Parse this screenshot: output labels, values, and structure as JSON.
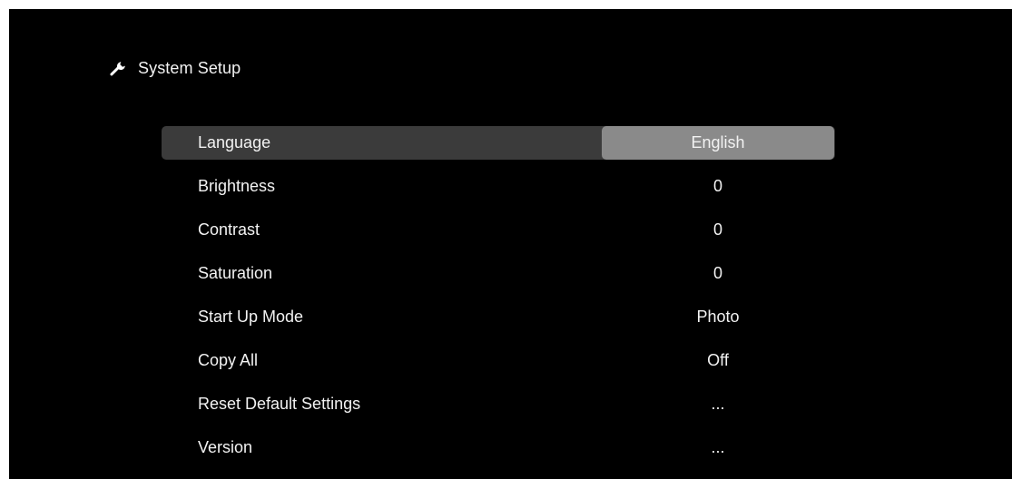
{
  "header": {
    "icon": "wrench-icon",
    "title": "System Setup"
  },
  "colors": {
    "background": "#000000",
    "text": "#f2f2f2",
    "selected_row": "#3b3b3b",
    "selected_value": "#8a8a8a"
  },
  "menu": {
    "selected_index": 0,
    "items": [
      {
        "label": "Language",
        "value": "English"
      },
      {
        "label": "Brightness",
        "value": "0"
      },
      {
        "label": "Contrast",
        "value": "0"
      },
      {
        "label": "Saturation",
        "value": "0"
      },
      {
        "label": "Start Up Mode",
        "value": "Photo"
      },
      {
        "label": "Copy All",
        "value": "Off"
      },
      {
        "label": "Reset Default Settings",
        "value": "..."
      },
      {
        "label": "Version",
        "value": "..."
      }
    ]
  }
}
